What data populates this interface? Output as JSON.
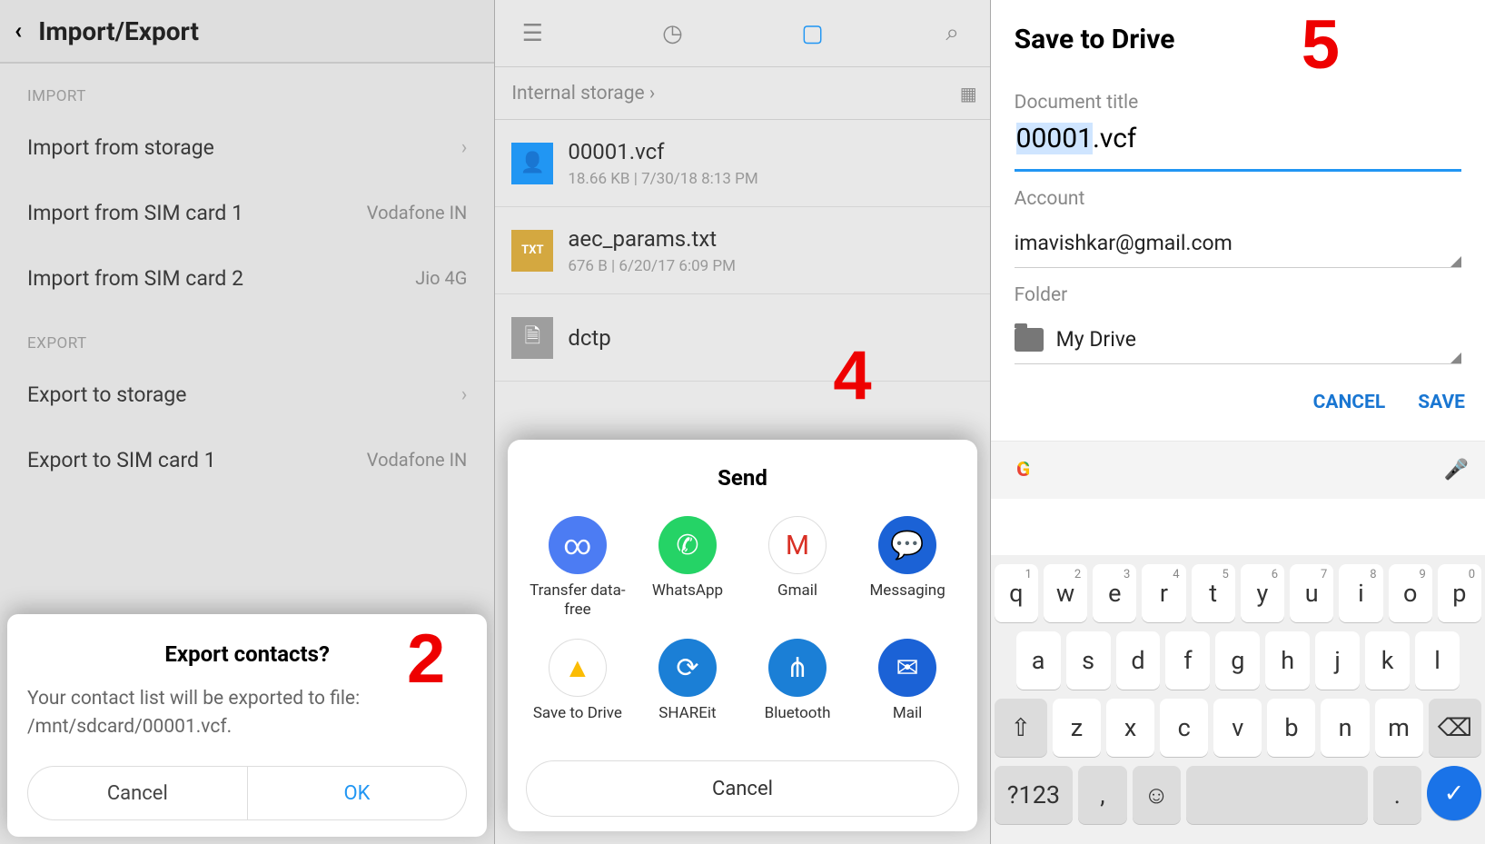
{
  "panel1": {
    "title": "Import/Export",
    "sections": {
      "import_label": "IMPORT",
      "export_label": "EXPORT"
    },
    "rows": {
      "import_storage": "Import from storage",
      "import_sim1": "Import from SIM card 1",
      "import_sim1_val": "Vodafone IN",
      "import_sim2": "Import from SIM card 2",
      "import_sim2_val": "Jio 4G",
      "export_storage": "Export to storage",
      "export_sim1": "Export to SIM card 1",
      "export_sim1_val": "Vodafone IN"
    },
    "dialog": {
      "title": "Export contacts?",
      "body": "Your contact list will be exported to file: /mnt/sdcard/00001.vcf.",
      "cancel": "Cancel",
      "ok": "OK"
    },
    "overlay": "2"
  },
  "panel2": {
    "breadcrumb": "Internal storage ›",
    "files": [
      {
        "name": "00001.vcf",
        "meta": "18.66 KB  |  7/30/18 8:13 PM",
        "icon": "person"
      },
      {
        "name": "aec_params.txt",
        "meta": "676 B  |  6/20/17 6:09 PM",
        "icon": "txt"
      },
      {
        "name": "dctp",
        "meta": "",
        "icon": "doc"
      }
    ],
    "sheet": {
      "title": "Send",
      "apps": [
        {
          "label": "Transfer data-free",
          "color": "#4c7cf3",
          "glyph": "∞"
        },
        {
          "label": "WhatsApp",
          "color": "#25d366",
          "glyph": "✆"
        },
        {
          "label": "Gmail",
          "color": "#ffffff",
          "glyph": "M",
          "text": "#d93025",
          "border": "#ddd"
        },
        {
          "label": "Messaging",
          "color": "#1b62d6",
          "glyph": "💬"
        },
        {
          "label": "Save to Drive",
          "color": "#ffffff",
          "glyph": "▲",
          "text": "#fbbc04",
          "border": "#ddd"
        },
        {
          "label": "SHAREit",
          "color": "#1b7fd6",
          "glyph": "⟳"
        },
        {
          "label": "Bluetooth",
          "color": "#1b7fd6",
          "glyph": "⋔"
        },
        {
          "label": "Mail",
          "color": "#1b62d6",
          "glyph": "✉"
        }
      ],
      "cancel": "Cancel"
    },
    "overlay": "4"
  },
  "panel3": {
    "title": "Save to Drive",
    "doc_label": "Document title",
    "doc_value": "00001.vcf",
    "doc_sel": "00001",
    "account_label": "Account",
    "account_value": "imavishkar@gmail.com",
    "folder_label": "Folder",
    "folder_value": "My Drive",
    "actions": {
      "cancel": "CANCEL",
      "save": "SAVE"
    },
    "keyboard": {
      "row1": [
        "q",
        "w",
        "e",
        "r",
        "t",
        "y",
        "u",
        "i",
        "o",
        "p"
      ],
      "row1sup": [
        "1",
        "2",
        "3",
        "4",
        "5",
        "6",
        "7",
        "8",
        "9",
        "0"
      ],
      "row2": [
        "a",
        "s",
        "d",
        "f",
        "g",
        "h",
        "j",
        "k",
        "l"
      ],
      "row3": [
        "z",
        "x",
        "c",
        "v",
        "b",
        "n",
        "m"
      ],
      "sym": "?123",
      "comma": ",",
      "period": "."
    },
    "overlay": "5"
  }
}
